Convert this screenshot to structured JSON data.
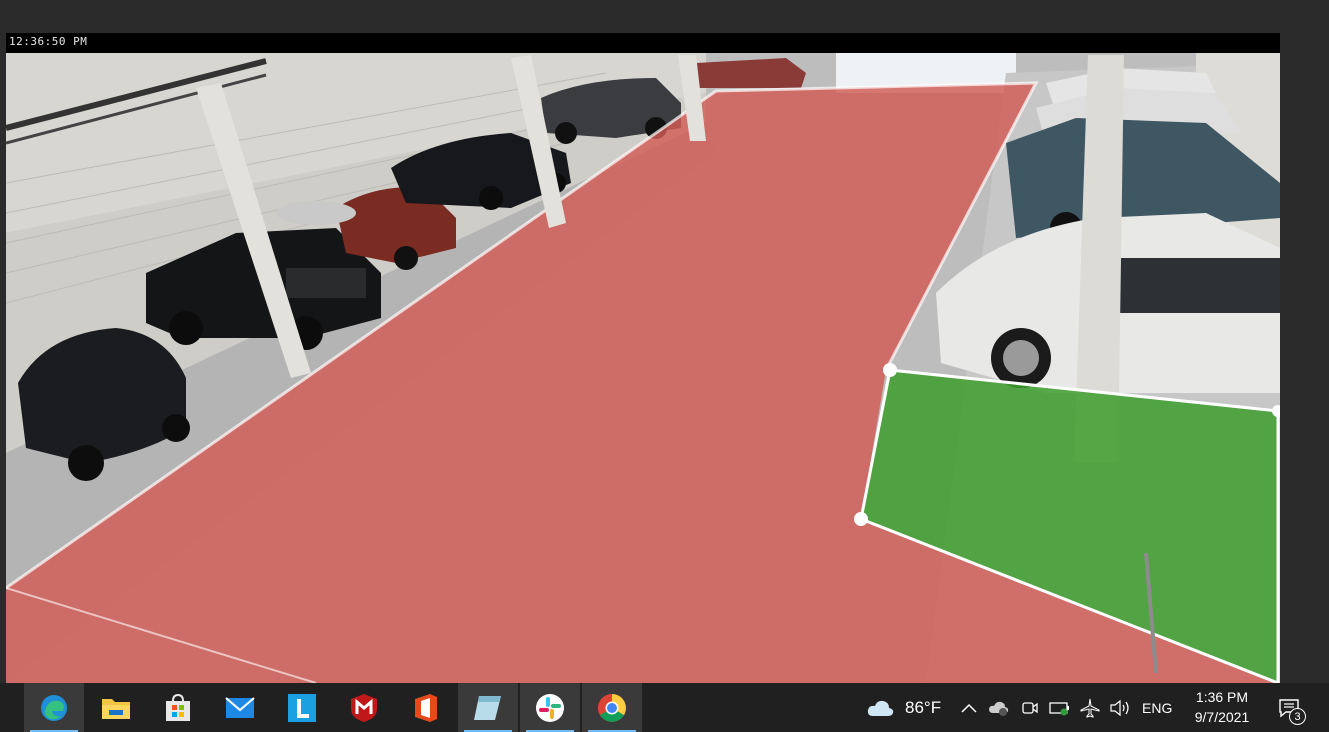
{
  "camera": {
    "timestamp": "12:36:50 PM",
    "zones": [
      {
        "name": "red-zone",
        "color": "#d9534f"
      },
      {
        "name": "green-zone",
        "color": "#3a9a2a"
      }
    ]
  },
  "taskbar": {
    "apps": [
      {
        "name": "edge",
        "icon": "edge-icon",
        "active": true
      },
      {
        "name": "file-explorer",
        "icon": "folder-icon",
        "active": false
      },
      {
        "name": "store",
        "icon": "store-icon",
        "active": false
      },
      {
        "name": "mail",
        "icon": "mail-icon",
        "active": false
      },
      {
        "name": "l-app",
        "icon": "l-app-icon",
        "active": false
      },
      {
        "name": "mcafee",
        "icon": "mcafee-icon",
        "active": false
      },
      {
        "name": "office",
        "icon": "office-icon",
        "active": false
      },
      {
        "name": "notes",
        "icon": "notes-icon",
        "active": true
      },
      {
        "name": "slack",
        "icon": "slack-icon",
        "active": true
      },
      {
        "name": "chrome",
        "icon": "chrome-icon",
        "active": true
      }
    ],
    "weather": {
      "temp": "86°F",
      "icon": "cloud-icon"
    },
    "language": "ENG",
    "clock": {
      "time": "1:36 PM",
      "date": "9/7/2021"
    },
    "notifications": {
      "count": "3"
    }
  }
}
